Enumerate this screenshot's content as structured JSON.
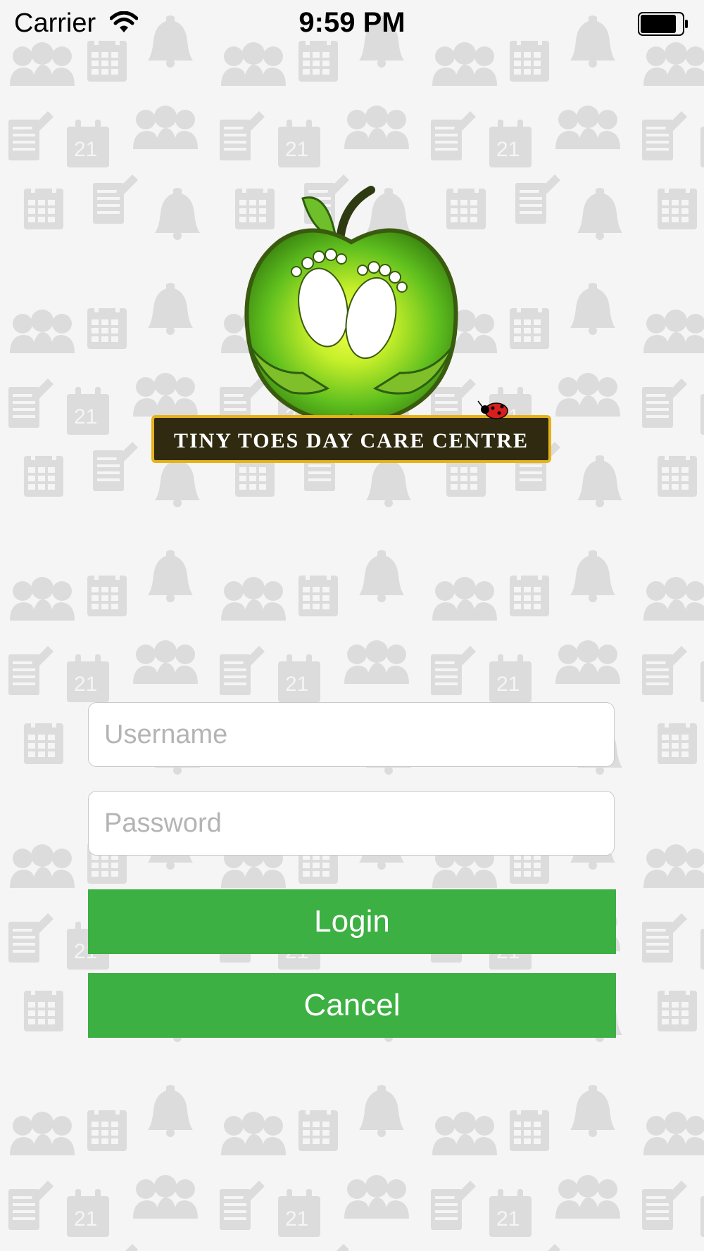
{
  "status_bar": {
    "carrier": "Carrier",
    "time": "9:59 PM",
    "wifi_icon": "wifi-icon",
    "battery_icon": "battery-icon"
  },
  "logo": {
    "text": "TINY TOES DAY CARE CENTRE"
  },
  "form": {
    "username_placeholder": "Username",
    "username_value": "",
    "password_placeholder": "Password",
    "password_value": "",
    "login_label": "Login",
    "cancel_label": "Cancel"
  },
  "colors": {
    "button_green": "#3cb043",
    "background": "#f5f5f5",
    "pattern_gray": "#dcdcdc"
  }
}
